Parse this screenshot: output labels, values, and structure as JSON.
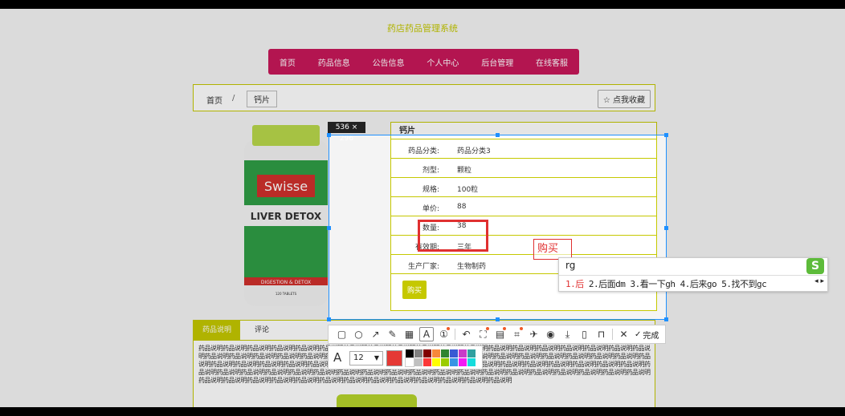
{
  "site": {
    "title": "药店药品管理系统"
  },
  "nav": [
    "首页",
    "药品信息",
    "公告信息",
    "个人中心",
    "后台管理",
    "在线客服"
  ],
  "breadcrumb": {
    "home": "首页",
    "sep": "/",
    "current": "钙片"
  },
  "favorite_label": "☆ 点我收藏",
  "product_image": {
    "brand": "Swisse",
    "name": "LIVER DETOX",
    "band": "DIGESTION & DETOX",
    "count": "120 TABLETS"
  },
  "info": {
    "title": "钙片",
    "rows": [
      {
        "k": "药品分类:",
        "v": "药品分类3"
      },
      {
        "k": "剂型:",
        "v": "颗粒"
      },
      {
        "k": "规格:",
        "v": "100粒"
      },
      {
        "k": "单价:",
        "v": "88"
      },
      {
        "k": "数量:",
        "v": "38"
      },
      {
        "k": "有效期:",
        "v": "三年"
      },
      {
        "k": "生产厂家:",
        "v": "生物制药"
      }
    ],
    "buy_label": "购买"
  },
  "tabs": {
    "active": "药品说明",
    "other": "评论"
  },
  "description": "药品说明药品说明药品说明药品说明药品说明药品说明药品说明药品说明药品说明药品说明药品说明药品说明药品说明药品说明药品说明药品说明药品说明药品说明药品说明药品说明药品说明药品说明药品说明药品说明药品说明药品说明药品说明药品说明药品说明药品说明药品说明药品说明药品说明药品说明药品说明药品说明药品说明药品说明药品说明药品说明药品说明药品说明药品说明药品说明药品说明药品说明药品说明药品说明药品说明药品说明药品说明药品说明药品说明药品说明药品说明药品说明药品说明药品说明药品说明药品说明药品说明药品说明药品说明药品说明药品说明药品说明药品说明药品说明药品说明药品说明药品说明药品说明药品说明药品说明药品说明药品说明药品说明药品说明药品说明药品说明药品说明药品说明药品说明药品说明药品说明药品说明药品说明药品说明",
  "capture": {
    "size_label": "536 × 296",
    "text_annotation": "购买",
    "done_label": "完成",
    "font_size": "12",
    "current_color": "#e53935",
    "swatches": [
      "#000000",
      "#808080",
      "#800000",
      "#f7883a",
      "#308430",
      "#385ad3",
      "#c83cc8",
      "#30a0a0",
      "#ffffff",
      "#c0c0c0",
      "#fb3838",
      "#ffff00",
      "#99cc00",
      "#3894e4",
      "#f31bf3",
      "#16dcdc"
    ],
    "tool_icons": [
      "rectangle-tool",
      "ellipse-tool",
      "arrow-tool",
      "pen-tool",
      "mosaic-tool",
      "text-tool",
      "number-tool",
      "undo",
      "screen-tool",
      "ocr-tool",
      "scan-tool",
      "pin",
      "record",
      "download",
      "phone",
      "bookmark",
      "close",
      "done"
    ]
  },
  "ime": {
    "input": "rg",
    "candidates_first": "1.后",
    "candidates_rest": "2.后面dm 3.看一下gh 4.后来go 5.找不到gc",
    "logo": "S"
  }
}
